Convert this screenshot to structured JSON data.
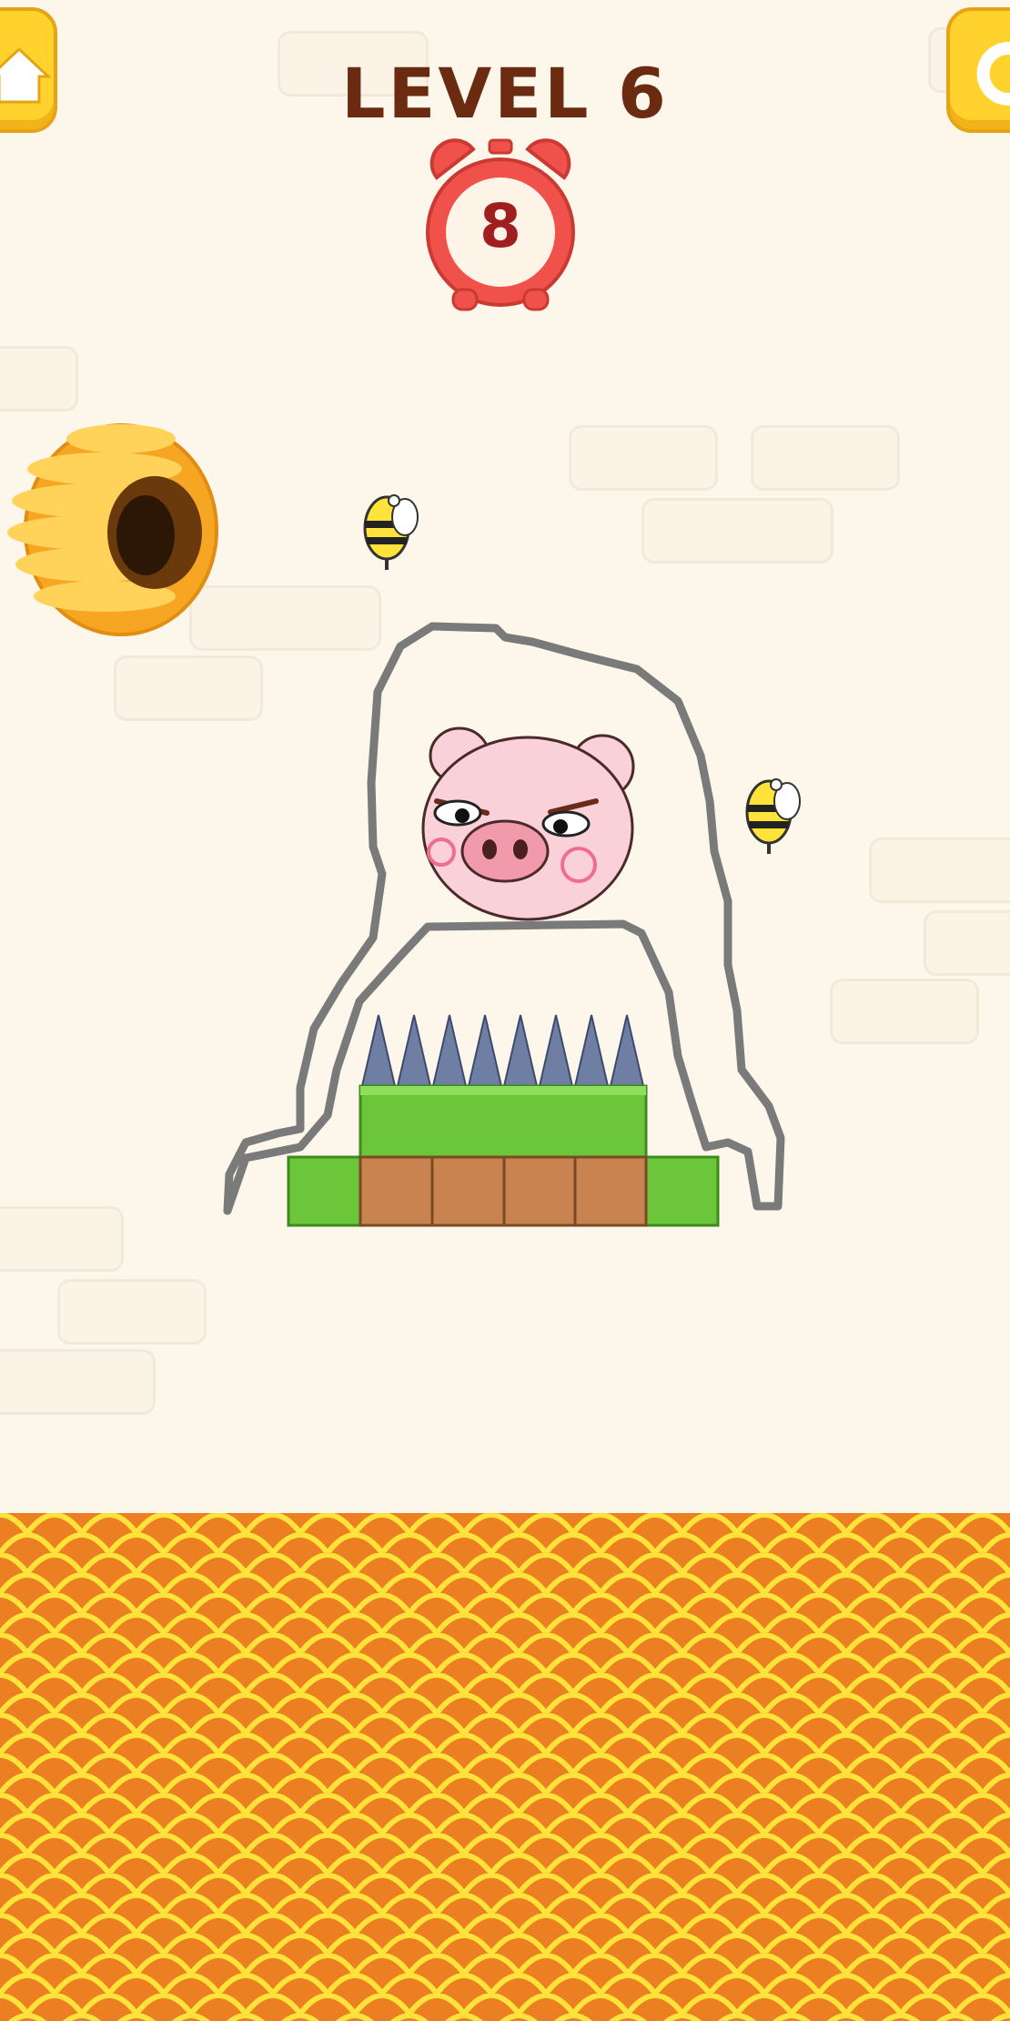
{
  "level": {
    "title": "LEVEL 6"
  },
  "timer": {
    "value": "8"
  },
  "buttons": {
    "home": "home-button",
    "restart": "restart-button"
  },
  "colors": {
    "background": "#fdf6eb",
    "lava": "#ec7f22",
    "lava_scale": "#ffe23a",
    "grass": "#6cc63a",
    "dirt": "#c88350",
    "spikes": "#6f7fa4",
    "pig": "#fbd1d9",
    "button": "#ffd22e"
  }
}
